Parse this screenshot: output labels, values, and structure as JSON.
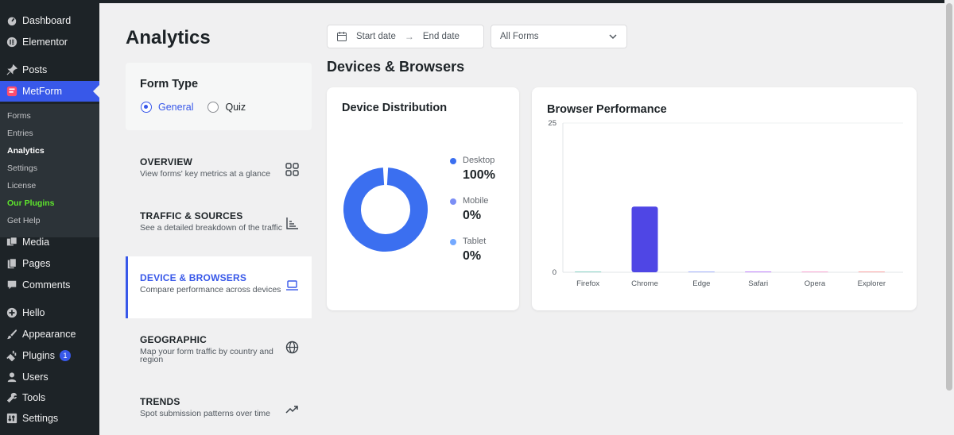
{
  "wp_menu": {
    "dashboard": "Dashboard",
    "elementor": "Elementor",
    "posts": "Posts",
    "metform": "MetForm",
    "media": "Media",
    "pages": "Pages",
    "comments": "Comments",
    "hello": "Hello",
    "appearance": "Appearance",
    "plugins": "Plugins",
    "plugins_badge": "1",
    "users": "Users",
    "tools": "Tools",
    "settings": "Settings"
  },
  "wp_submenu": {
    "forms": "Forms",
    "entries": "Entries",
    "analytics": "Analytics",
    "settings": "Settings",
    "license": "License",
    "our_plugins": "Our Plugins",
    "get_help": "Get Help"
  },
  "page": {
    "title": "Analytics"
  },
  "filters": {
    "start_date": "Start date",
    "end_date": "End date",
    "form_select": "All Forms"
  },
  "section_title": "Devices & Browsers",
  "form_type": {
    "title": "Form Type",
    "general": "General",
    "quiz": "Quiz",
    "selected": "General"
  },
  "nav": {
    "overview": {
      "title": "OVERVIEW",
      "desc": "View forms' key metrics at a glance"
    },
    "traffic": {
      "title": "TRAFFIC & SOURCES",
      "desc": "See a detailed breakdown of the traffic"
    },
    "devices": {
      "title": "DEVICE & BROWSERS",
      "desc": "Compare performance across devices"
    },
    "geographic": {
      "title": "GEOGRAPHIC",
      "desc": "Map your form traffic by country and region"
    },
    "trends": {
      "title": "TRENDS",
      "desc": "Spot submission patterns over time"
    }
  },
  "device_card": {
    "title": "Device Distribution",
    "legend": [
      {
        "label": "Desktop",
        "value": "100%",
        "color": "#3b6ff0"
      },
      {
        "label": "Mobile",
        "value": "0%",
        "color": "#7b8ef5"
      },
      {
        "label": "Tablet",
        "value": "0%",
        "color": "#74a9ff"
      }
    ]
  },
  "browser_card": {
    "title": "Browser Performance"
  },
  "chart_data": [
    {
      "type": "pie",
      "categories": [
        "Desktop",
        "Mobile",
        "Tablet"
      ],
      "values": [
        100,
        0,
        0
      ],
      "title": "Device Distribution",
      "legend": "right",
      "colors": [
        "#3b6ff0",
        "#7b8ef5",
        "#74a9ff"
      ]
    },
    {
      "type": "bar",
      "title": "Browser Performance",
      "categories": [
        "Firefox",
        "Chrome",
        "Edge",
        "Safari",
        "Opera",
        "Explorer"
      ],
      "values": [
        0,
        11,
        0,
        0,
        0,
        0
      ],
      "ylim": [
        0,
        25
      ],
      "yticks": [
        "0",
        "25"
      ],
      "colors": [
        "#8bd3c7",
        "#4f46e5",
        "#a5b4fc",
        "#c084fc",
        "#f9a8d4",
        "#fca5a5"
      ],
      "grid": true
    }
  ],
  "colors": {
    "accent": "#3858e9",
    "sidebar": "#1d2327",
    "green": "#5ee52d"
  }
}
